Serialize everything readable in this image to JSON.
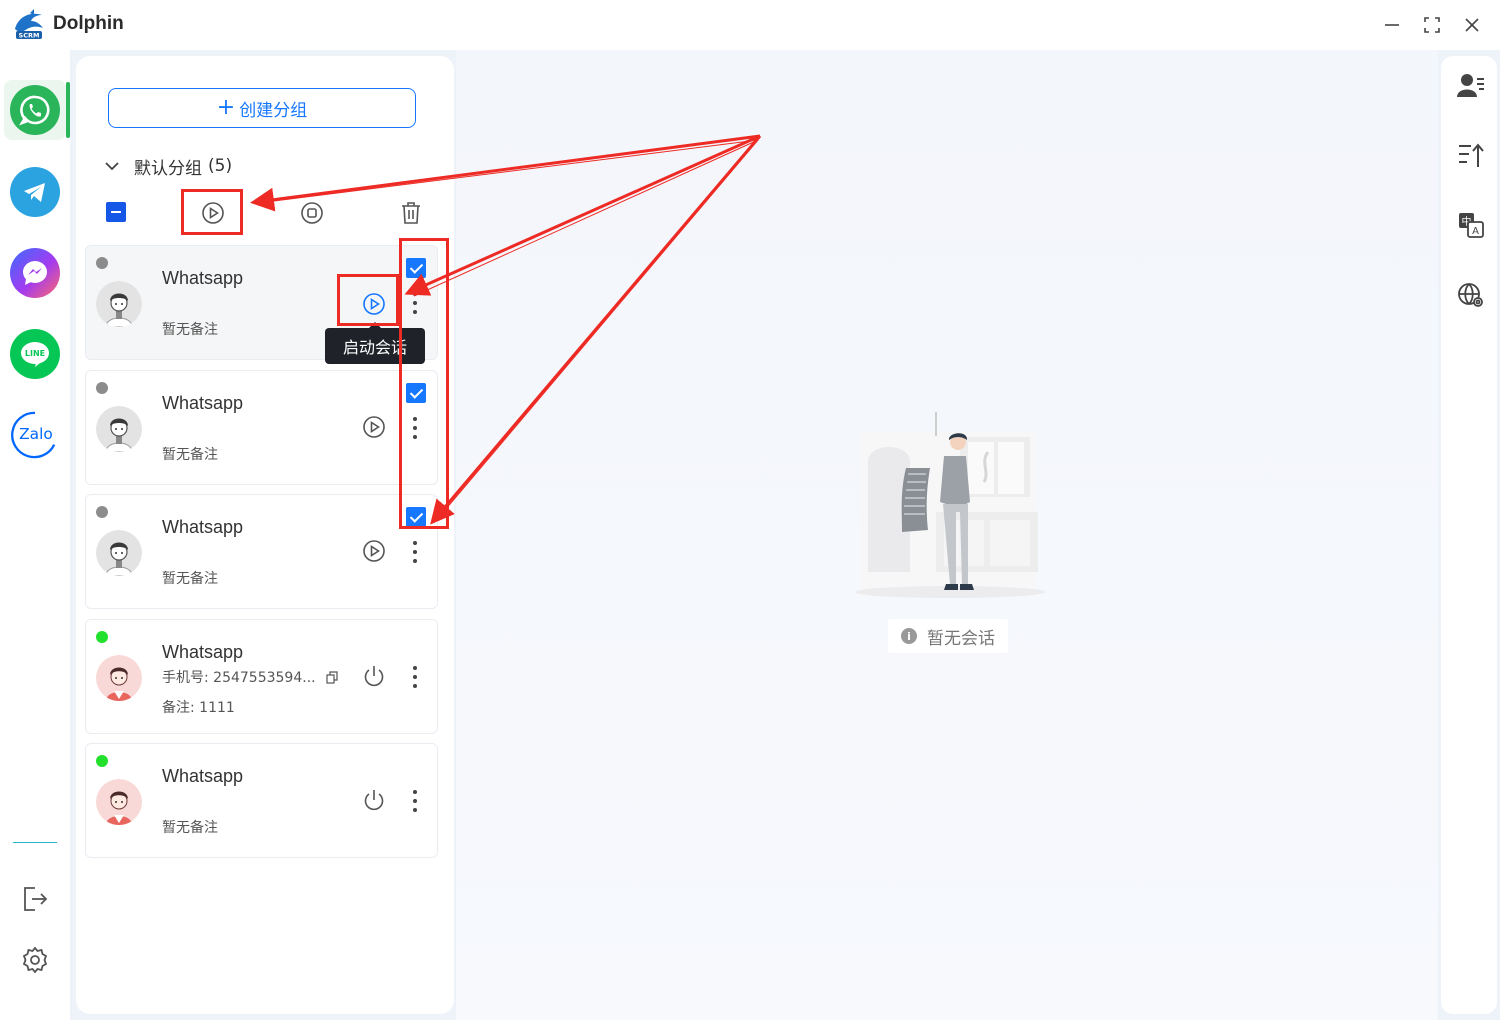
{
  "window": {
    "title": "Dolphin",
    "logo_text": "SCRM",
    "controls": [
      "minimize",
      "maximize",
      "close"
    ]
  },
  "left_rail": {
    "apps": [
      {
        "name": "WhatsApp",
        "icon": "whatsapp-icon",
        "color": "#2ab55b",
        "active": true
      },
      {
        "name": "Telegram",
        "icon": "telegram-icon",
        "color": "#2aa3e0"
      },
      {
        "name": "Messenger",
        "icon": "messenger-icon",
        "color": "#a33bf0"
      },
      {
        "name": "LINE",
        "icon": "line-icon",
        "color": "#06c755",
        "label": "LINE"
      },
      {
        "name": "Zalo",
        "icon": "zalo-icon",
        "color": "#0068ff",
        "label": "Zalo"
      }
    ],
    "bottom": [
      "logout-icon",
      "settings-icon"
    ]
  },
  "panel": {
    "create_group_label": "创建分组",
    "group": {
      "name": "默认分组",
      "count_label": "(5)",
      "expanded": true
    },
    "toolbar": {
      "select_all_state": "indeterminate",
      "actions": [
        "start-all",
        "stop-all",
        "delete"
      ]
    },
    "accounts": [
      {
        "name": "Whatsapp",
        "status": "offline",
        "status_color": "#8c8c8c",
        "line1": "",
        "line2": "暂无备注",
        "action": "start",
        "checked": true,
        "avatar": "grey",
        "hover": true
      },
      {
        "name": "Whatsapp",
        "status": "offline",
        "status_color": "#8c8c8c",
        "line1": "",
        "line2": "暂无备注",
        "action": "start",
        "checked": true,
        "avatar": "grey"
      },
      {
        "name": "Whatsapp",
        "status": "offline",
        "status_color": "#8c8c8c",
        "line1": "",
        "line2": "暂无备注",
        "action": "start",
        "checked": true,
        "avatar": "grey"
      },
      {
        "name": "Whatsapp",
        "status": "online",
        "status_color": "#22e02c",
        "line1": "手机号: 2547553594...",
        "line2": "备注: 1111",
        "action": "power",
        "checked": false,
        "avatar": "pink"
      },
      {
        "name": "Whatsapp",
        "status": "online",
        "status_color": "#22e02c",
        "line1": "",
        "line2": "暂无备注",
        "action": "power",
        "checked": false,
        "avatar": "pink"
      }
    ],
    "tooltip": "启动会话"
  },
  "main": {
    "empty_text": "暂无会话",
    "info_glyph": "i"
  },
  "right_rail": {
    "icons": [
      "contacts-icon",
      "sort-upload-icon",
      "translate-icon",
      "globe-settings-icon"
    ]
  },
  "colors": {
    "accent": "#1677ff",
    "annotation": "#ee2a24",
    "whatsapp": "#2ab55b"
  }
}
